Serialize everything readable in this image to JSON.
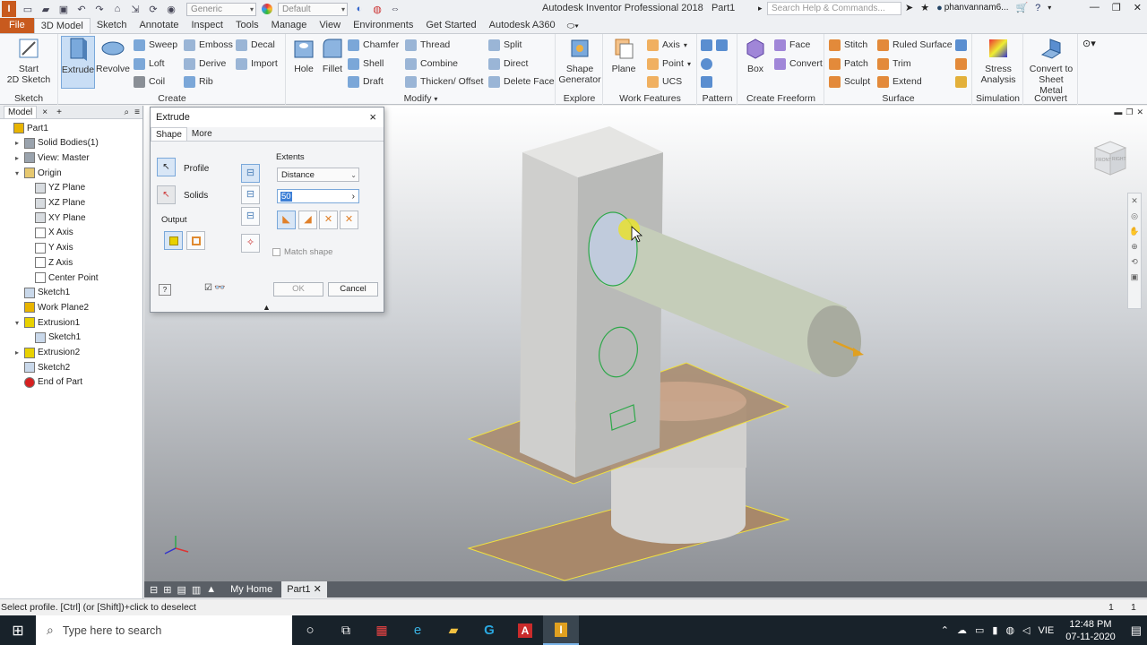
{
  "app": {
    "title": "Autodesk Inventor Professional 2018",
    "document": "Part1",
    "material_combo": "Generic",
    "appearance_combo": "Default",
    "help_search_placeholder": "Search Help & Commands...",
    "user": "phanvannam6..."
  },
  "menu": {
    "tabs": [
      "File",
      "3D Model",
      "Sketch",
      "Annotate",
      "Inspect",
      "Tools",
      "Manage",
      "View",
      "Environments",
      "Get Started",
      "Autodesk A360"
    ],
    "active": "3D Model"
  },
  "ribbon": {
    "sketch": {
      "title": "Sketch",
      "start": "Start\n2D Sketch"
    },
    "create": {
      "title": "Create",
      "extrude": "Extrude",
      "revolve": "Revolve",
      "sweep": "Sweep",
      "emboss": "Emboss",
      "decal": "Decal",
      "loft": "Loft",
      "derive": "Derive",
      "import": "Import",
      "coil": "Coil",
      "rib": "Rib"
    },
    "modify": {
      "title": "Modify",
      "hole": "Hole",
      "fillet": "Fillet",
      "chamfer": "Chamfer",
      "thread": "Thread",
      "split": "Split",
      "shell": "Shell",
      "combine": "Combine",
      "direct": "Direct",
      "draft": "Draft",
      "thicken": "Thicken/ Offset",
      "delete_face": "Delete Face"
    },
    "explore": {
      "title": "Explore",
      "shape_gen": "Shape\nGenerator"
    },
    "work_features": {
      "title": "Work Features",
      "plane": "Plane",
      "axis": "Axis",
      "point": "Point",
      "ucs": "UCS"
    },
    "pattern": {
      "title": "Pattern"
    },
    "freeform": {
      "title": "Create Freeform",
      "box": "Box",
      "face": "Face",
      "convert": "Convert"
    },
    "surface": {
      "title": "Surface",
      "stitch": "Stitch",
      "ruled": "Ruled Surface",
      "patch": "Patch",
      "trim": "Trim",
      "sculpt": "Sculpt",
      "extend": "Extend"
    },
    "simulation": {
      "title": "Simulation",
      "stress": "Stress\nAnalysis"
    },
    "convert": {
      "title": "Convert",
      "sheet": "Convert to\nSheet Metal"
    }
  },
  "browser": {
    "tab": "Model",
    "nodes": [
      {
        "label": "Part1",
        "level": 0,
        "toggle": "",
        "icon": "#e8b400"
      },
      {
        "label": "Solid Bodies(1)",
        "level": 1,
        "toggle": "▸",
        "icon": "#9aa3ad"
      },
      {
        "label": "View: Master",
        "level": 1,
        "toggle": "▸",
        "icon": "#9aa3ad"
      },
      {
        "label": "Origin",
        "level": 1,
        "toggle": "▾",
        "icon": "#e6c870"
      },
      {
        "label": "YZ Plane",
        "level": 2,
        "toggle": "",
        "icon": "#d8dce0"
      },
      {
        "label": "XZ Plane",
        "level": 2,
        "toggle": "",
        "icon": "#d8dce0"
      },
      {
        "label": "XY Plane",
        "level": 2,
        "toggle": "",
        "icon": "#d8dce0"
      },
      {
        "label": "X Axis",
        "level": 2,
        "toggle": "",
        "icon": "#ffffff"
      },
      {
        "label": "Y Axis",
        "level": 2,
        "toggle": "",
        "icon": "#ffffff"
      },
      {
        "label": "Z Axis",
        "level": 2,
        "toggle": "",
        "icon": "#ffffff"
      },
      {
        "label": "Center Point",
        "level": 2,
        "toggle": "",
        "icon": "#ffffff"
      },
      {
        "label": "Sketch1",
        "level": 1,
        "toggle": "",
        "icon": "#c9d8ea"
      },
      {
        "label": "Work Plane2",
        "level": 1,
        "toggle": "",
        "icon": "#e8b400"
      },
      {
        "label": "Extrusion1",
        "level": 1,
        "toggle": "▾",
        "icon": "#e8d100"
      },
      {
        "label": "Sketch1",
        "level": 2,
        "toggle": "",
        "icon": "#c9d8ea"
      },
      {
        "label": "Extrusion2",
        "level": 1,
        "toggle": "▸",
        "icon": "#e8d100"
      },
      {
        "label": "Sketch2",
        "level": 1,
        "toggle": "",
        "icon": "#c9d8ea"
      },
      {
        "label": "End of Part",
        "level": 1,
        "toggle": "",
        "icon": "#d62020"
      }
    ]
  },
  "dialog": {
    "title": "Extrude",
    "tabs": [
      "Shape",
      "More"
    ],
    "active_tab": "Shape",
    "profile": "Profile",
    "solids": "Solids",
    "output": "Output",
    "extents": "Extents",
    "extents_value": "Distance",
    "distance_value": "50",
    "match_shape": "Match shape",
    "match_shape_checked": false,
    "ok": "OK",
    "cancel": "Cancel"
  },
  "viewcube": {
    "front": "FRONT",
    "right": "RIGHT"
  },
  "doc_tabs": {
    "home": "My Home",
    "part": "Part1"
  },
  "status": {
    "message": "Select profile. [Ctrl] (or [Shift])+click to deselect",
    "count1": "1",
    "count2": "1"
  },
  "taskbar": {
    "search_placeholder": "Type here to search",
    "time": "12:48 PM",
    "date": "07-11-2020",
    "lang": "VIE"
  }
}
